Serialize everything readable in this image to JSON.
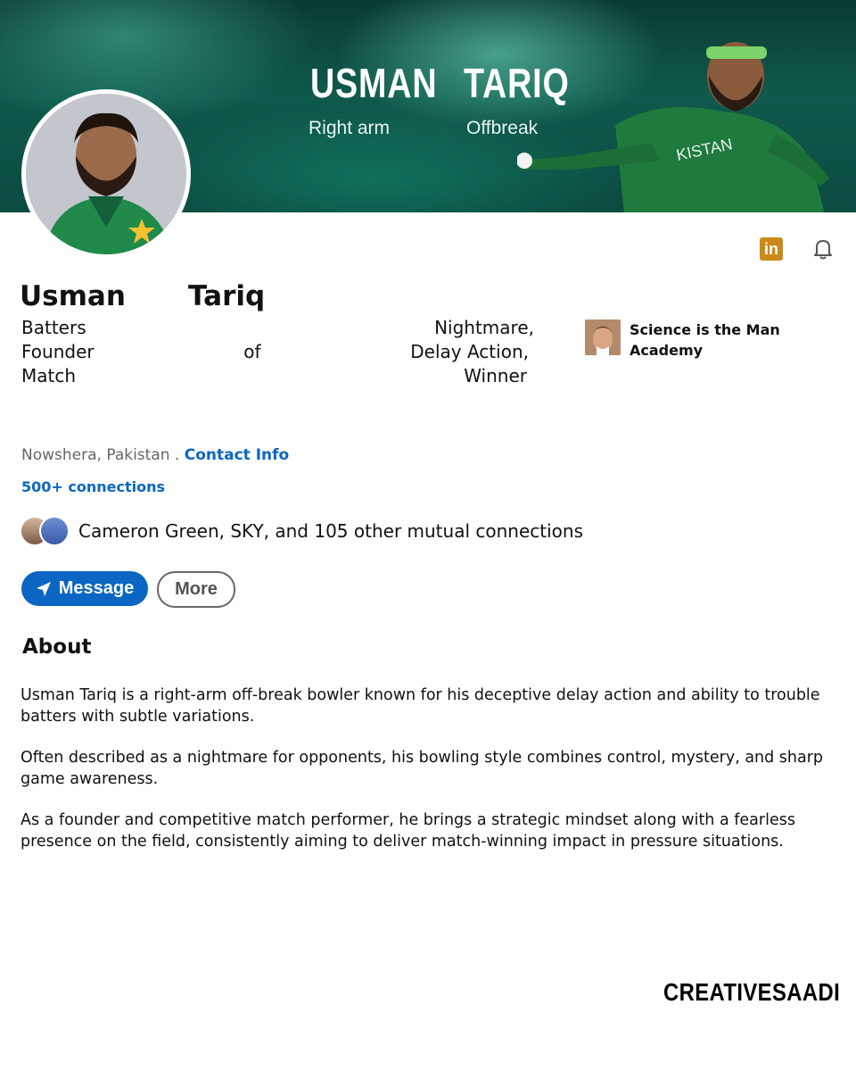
{
  "banner": {
    "first_name": "USMAN",
    "last_name": "TARIQ",
    "sub_left": "Right arm",
    "sub_right": "Offbreak"
  },
  "icons": {
    "linkedin": "in",
    "bell": "bell-icon"
  },
  "profile": {
    "first_name": "Usman",
    "last_name": "Tariq",
    "headline_lines": [
      [
        "Batters",
        "Nightmare,"
      ],
      [
        "Founder",
        "of",
        "Delay Action,"
      ],
      [
        "Match",
        "Winner"
      ]
    ],
    "company": "Science is the Man Academy",
    "location": "Nowshera, Pakistan .",
    "contact_info": "Contact Info",
    "connections": "500+ connections",
    "mutual": "Cameron Green, SKY, and 105 other mutual connections"
  },
  "actions": {
    "message": "Message",
    "more": "More"
  },
  "about": {
    "title": "About",
    "paragraphs": [
      "Usman Tariq is a right-arm off-break bowler known for his deceptive delay action and ability to trouble batters with subtle variations.",
      "Often described as a nightmare for opponents, his bowling style combines control, mystery, and sharp game awareness.",
      "As a founder and competitive match performer, he brings a strategic mindset along with a fearless presence on the field, consistently aiming to deliver match-winning impact in pressure situations."
    ]
  },
  "brand": "CREATIVESAADI",
  "colors": {
    "link_blue": "#0a66c2",
    "banner_green": "#0f5a4c",
    "linkedin_badge": "#c98a1a"
  }
}
